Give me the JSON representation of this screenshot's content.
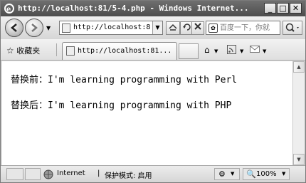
{
  "window": {
    "title": "http://localhost:81/5-4.php - Windows Internet...",
    "buttons": {
      "minimize": "_",
      "maximize": "□",
      "close": "✕"
    }
  },
  "nav": {
    "address": "http://localhost:8",
    "search_placeholder": "百度一下，你就",
    "icons": [
      "back-icon",
      "forward-icon",
      "refresh-icon",
      "stop-icon",
      "search-icon"
    ]
  },
  "tabs": {
    "favorites_label": "收藏夹",
    "active_tab": "http://localhost:81..."
  },
  "content": {
    "line1": "替换前：I'm learning programming with Perl",
    "line2": "替换后：I'm learning programming with PHP"
  },
  "status": {
    "zone": "Internet",
    "protected_mode": "保护模式: 启用",
    "zoom": "100%"
  }
}
